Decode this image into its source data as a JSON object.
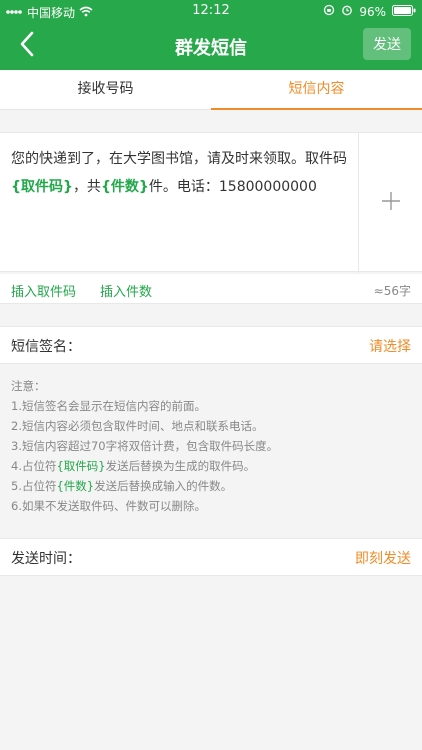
{
  "status_bar": {
    "carrier": "中国移动",
    "time": "12:12",
    "battery": "96%"
  },
  "nav": {
    "title": "群发短信",
    "send_label": "发送"
  },
  "tabs": [
    {
      "label": "接收号码",
      "active": false
    },
    {
      "label": "短信内容",
      "active": true
    }
  ],
  "message": {
    "part1": "您的快递到了，在大学图书馆，请及时来领取。取件码",
    "placeholder_code": "{取件码}",
    "part2": "，共",
    "placeholder_count": "{件数}",
    "part3": "件。电话：15800000000"
  },
  "insert": {
    "code_label": "插入取件码",
    "count_label": "插入件数",
    "char_count": "≈56字"
  },
  "signature": {
    "label": "短信签名：",
    "value": "请选择"
  },
  "notes": {
    "title": "注意：",
    "n1": "1.短信签名会显示在短信内容的前面。",
    "n2": "2.短信内容必须包含取件时间、地点和联系电话。",
    "n3": "3.短信内容超过70字将双倍计费，包含取件码长度。",
    "n4_prefix": "4.占位符",
    "n4_ph": "{取件码}",
    "n4_suffix": "发送后替换为生成的取件码。",
    "n5_prefix": "5.占位符",
    "n5_ph": "{件数}",
    "n5_suffix": "发送后替换成输入的件数。",
    "n6": "6.如果不发送取件码、件数可以删除。"
  },
  "send_time": {
    "label": "发送时间：",
    "value": "即刻发送"
  },
  "colors": {
    "brand_green": "#27a84a",
    "accent_orange": "#f28c28"
  },
  "icons": {
    "back": "chevron-left-icon",
    "add": "plus-icon",
    "wifi": "wifi-icon",
    "battery": "battery-icon"
  }
}
